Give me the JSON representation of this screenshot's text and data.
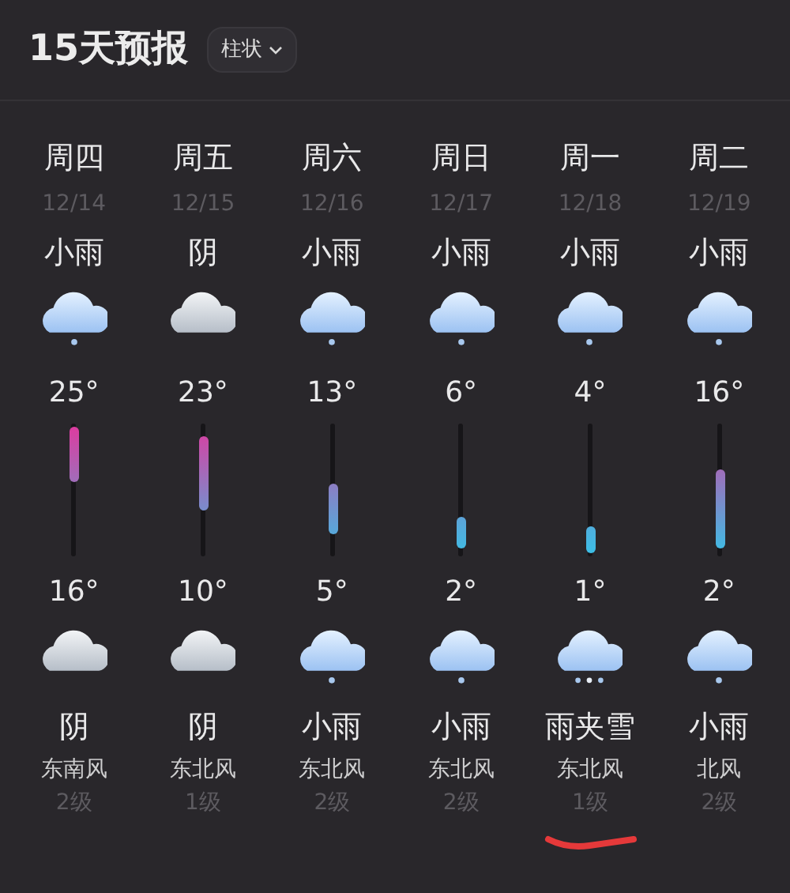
{
  "header": {
    "title": "15天预报",
    "view_toggle": "柱状"
  },
  "days": [
    {
      "weekday": "周四",
      "date": "12/14",
      "day_weather": "小雨",
      "day_icon": {
        "kind": "rain"
      },
      "high": "25°",
      "low": "16°",
      "night_icon": {
        "kind": "cloud"
      },
      "night_weather": "阴",
      "wind": "东南风",
      "wind_level": "2级",
      "underlined": false
    },
    {
      "weekday": "周五",
      "date": "12/15",
      "day_weather": "阴",
      "day_icon": {
        "kind": "cloud"
      },
      "high": "23°",
      "low": "10°",
      "night_icon": {
        "kind": "cloud"
      },
      "night_weather": "阴",
      "wind": "东北风",
      "wind_level": "1级",
      "underlined": false
    },
    {
      "weekday": "周六",
      "date": "12/16",
      "day_weather": "小雨",
      "day_icon": {
        "kind": "rain"
      },
      "high": "13°",
      "low": "5°",
      "night_icon": {
        "kind": "rain"
      },
      "night_weather": "小雨",
      "wind": "东北风",
      "wind_level": "2级",
      "underlined": false
    },
    {
      "weekday": "周日",
      "date": "12/17",
      "day_weather": "小雨",
      "day_icon": {
        "kind": "rain"
      },
      "high": "6°",
      "low": "2°",
      "night_icon": {
        "kind": "rain"
      },
      "night_weather": "小雨",
      "wind": "东北风",
      "wind_level": "2级",
      "underlined": false
    },
    {
      "weekday": "周一",
      "date": "12/18",
      "day_weather": "小雨",
      "day_icon": {
        "kind": "rain"
      },
      "high": "4°",
      "low": "1°",
      "night_icon": {
        "kind": "sleet"
      },
      "night_weather": "雨夹雪",
      "wind": "东北风",
      "wind_level": "1级",
      "underlined": true
    },
    {
      "weekday": "周二",
      "date": "12/19",
      "day_weather": "小雨",
      "day_icon": {
        "kind": "rain"
      },
      "high": "16°",
      "low": "2°",
      "night_icon": {
        "kind": "rain"
      },
      "night_weather": "小雨",
      "wind": "北风",
      "wind_level": "2级",
      "underlined": false
    }
  ]
}
